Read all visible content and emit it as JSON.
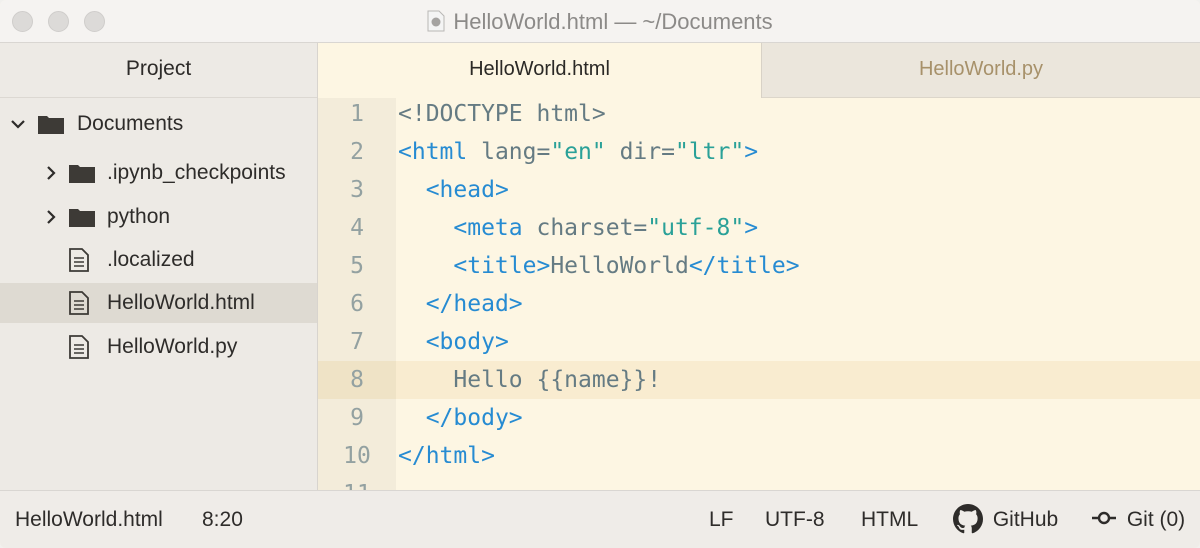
{
  "window": {
    "title": "HelloWorld.html — ~/Documents"
  },
  "sidebar": {
    "header": "Project",
    "items": [
      {
        "label": "Documents",
        "type": "folder",
        "expanded": true
      },
      {
        "label": ".ipynb_checkpoints",
        "type": "folder",
        "expanded": false
      },
      {
        "label": "python",
        "type": "folder",
        "expanded": false
      },
      {
        "label": ".localized",
        "type": "file"
      },
      {
        "label": "HelloWorld.html",
        "type": "file",
        "selected": true
      },
      {
        "label": "HelloWorld.py",
        "type": "file"
      }
    ]
  },
  "tabs": [
    {
      "label": "HelloWorld.html",
      "active": true
    },
    {
      "label": "HelloWorld.py",
      "active": false
    }
  ],
  "editor": {
    "current_line": 8,
    "lines": [
      {
        "number": "1",
        "text": "<!DOCTYPE html>"
      },
      {
        "number": "2",
        "text": "<html lang=\"en\" dir=\"ltr\">"
      },
      {
        "number": "3",
        "text": "  <head>"
      },
      {
        "number": "4",
        "text": "    <meta charset=\"utf-8\">"
      },
      {
        "number": "5",
        "text": "    <title>HelloWorld</title>"
      },
      {
        "number": "6",
        "text": "  </head>"
      },
      {
        "number": "7",
        "text": "  <body>"
      },
      {
        "number": "8",
        "text": "    Hello {{name}}!"
      },
      {
        "number": "9",
        "text": "  </body>"
      },
      {
        "number": "10",
        "text": "</html>"
      },
      {
        "number": "11",
        "text": ""
      }
    ]
  },
  "statusbar": {
    "file": "HelloWorld.html",
    "cursor": "8:20",
    "line_ending": "LF",
    "encoding": "UTF-8",
    "grammar": "HTML",
    "github": "GitHub",
    "git": "Git (0)"
  },
  "colors": {
    "editor_bg": "#fdf6e3",
    "tag": "#268bd2",
    "string": "#2aa198",
    "text": "#657b83",
    "line_number": "#93a1a1"
  },
  "icons": [
    "document-proxy-icon",
    "chevron-down-icon",
    "chevron-right-icon",
    "folder-icon",
    "file-icon",
    "github-icon",
    "git-commit-icon"
  ]
}
